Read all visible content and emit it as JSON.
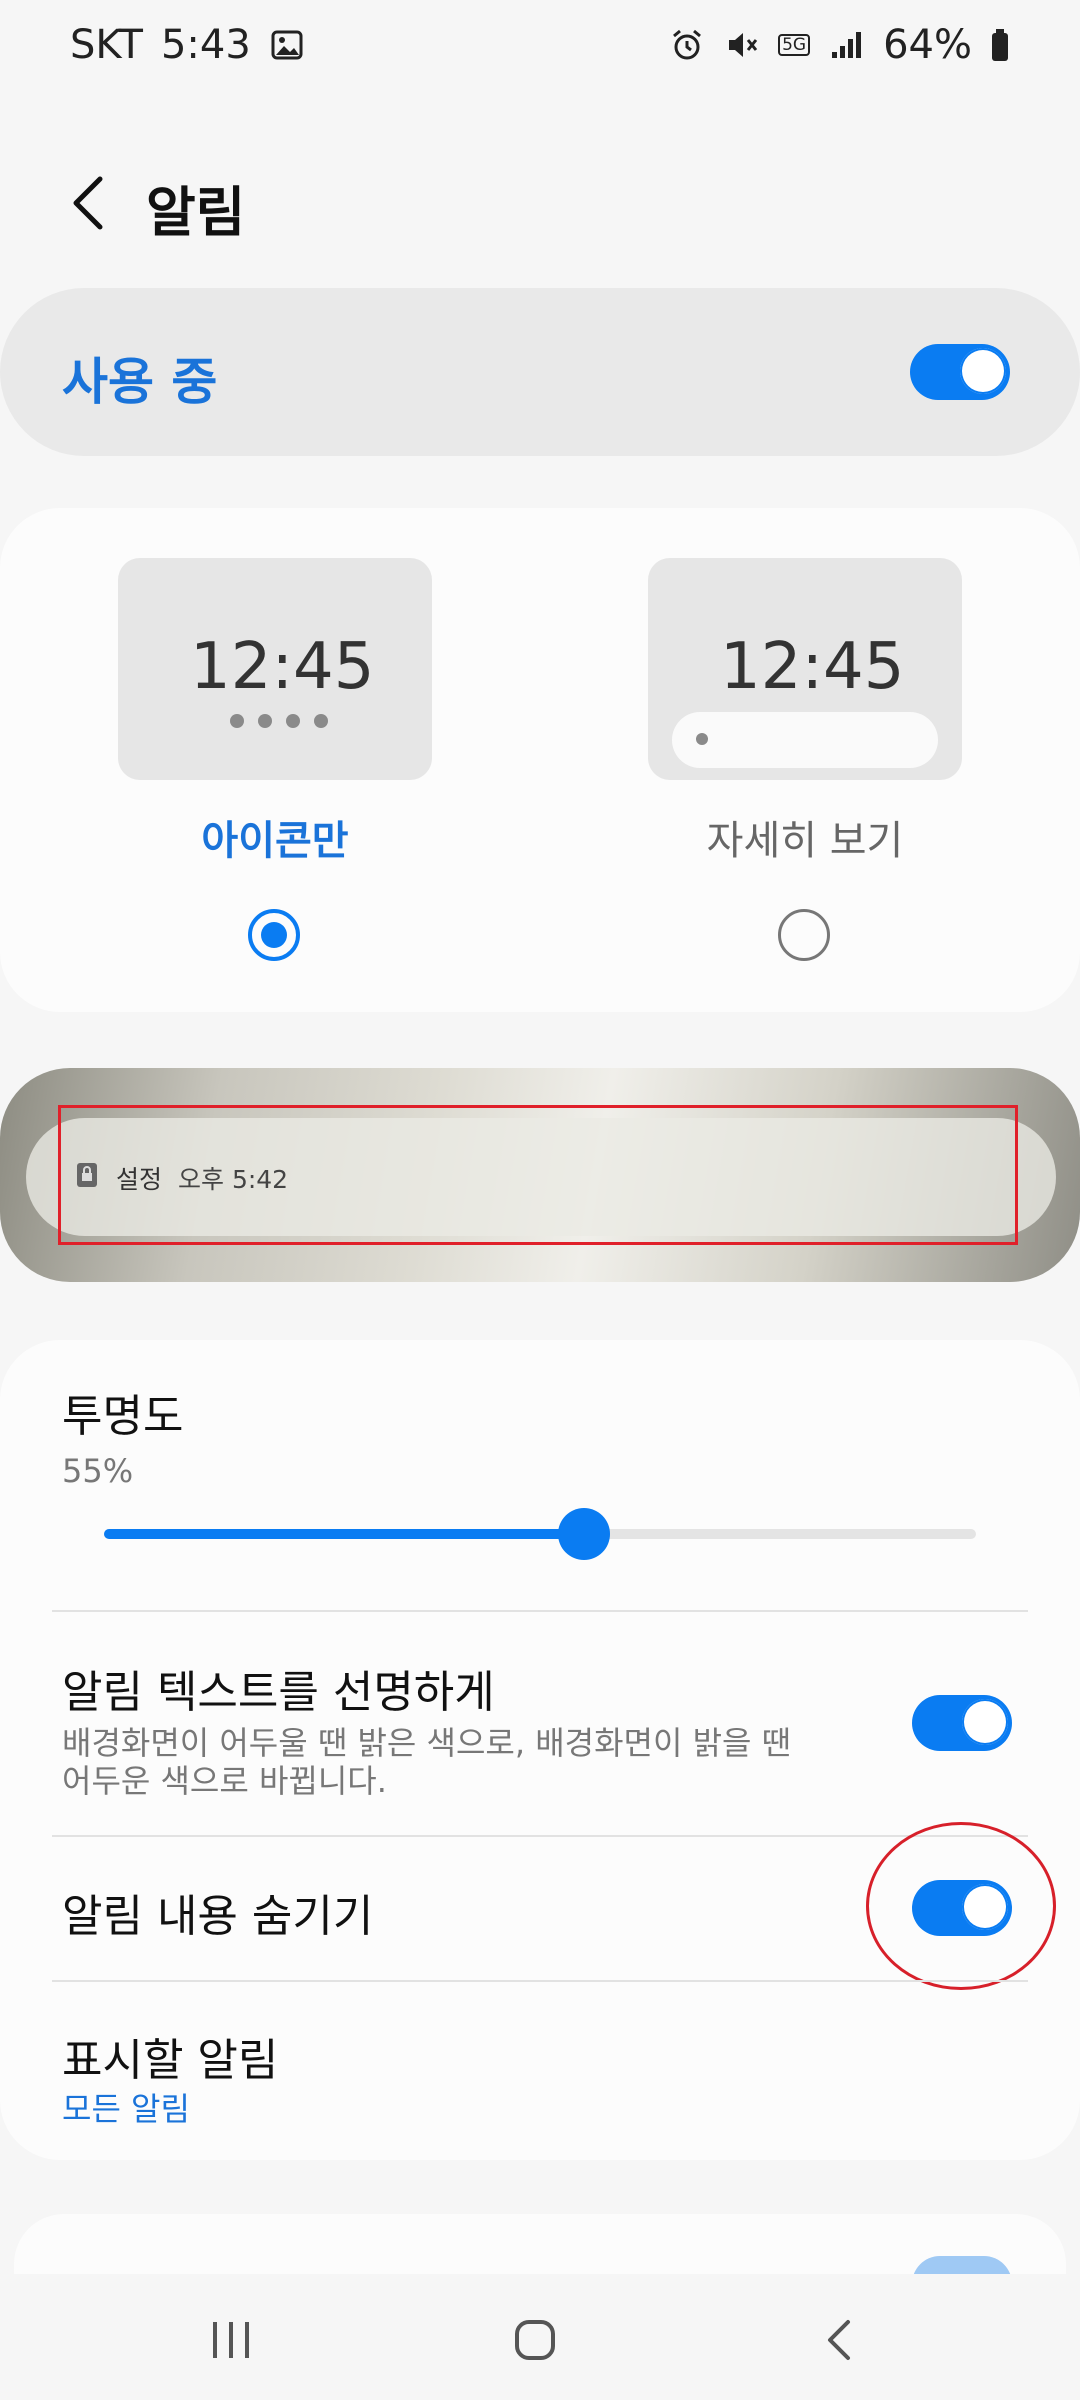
{
  "status_bar": {
    "carrier": "SKT",
    "time": "5:43",
    "network": "5G",
    "battery": "64%"
  },
  "header": {
    "title": "알림"
  },
  "master": {
    "label": "사용 중",
    "enabled": true
  },
  "styles": {
    "options": [
      {
        "label": "아이콘만",
        "time": "12:45",
        "selected": true
      },
      {
        "label": "자세히 보기",
        "time": "12:45",
        "selected": false
      }
    ]
  },
  "preview_notification": {
    "app": "설정",
    "time": "오후 5:42"
  },
  "settings": {
    "transparency": {
      "title": "투명도",
      "value_label": "55%",
      "value": 0.55
    },
    "bright_text": {
      "title": "알림 텍스트를 선명하게",
      "description_line1": "배경화면이 어두울 땐 밝은 색으로, 배경화면이 밝을 땐",
      "description_line2": "어두운 색으로 바뀝니다.",
      "enabled": true
    },
    "hide_content": {
      "title": "알림 내용 숨기기",
      "enabled": true
    },
    "show_notifications": {
      "title": "표시할 알림",
      "value": "모든 알림"
    }
  },
  "colors": {
    "accent": "#0a7cf2",
    "accent_text": "#1a73d9",
    "annotation_red": "#e0202a"
  }
}
